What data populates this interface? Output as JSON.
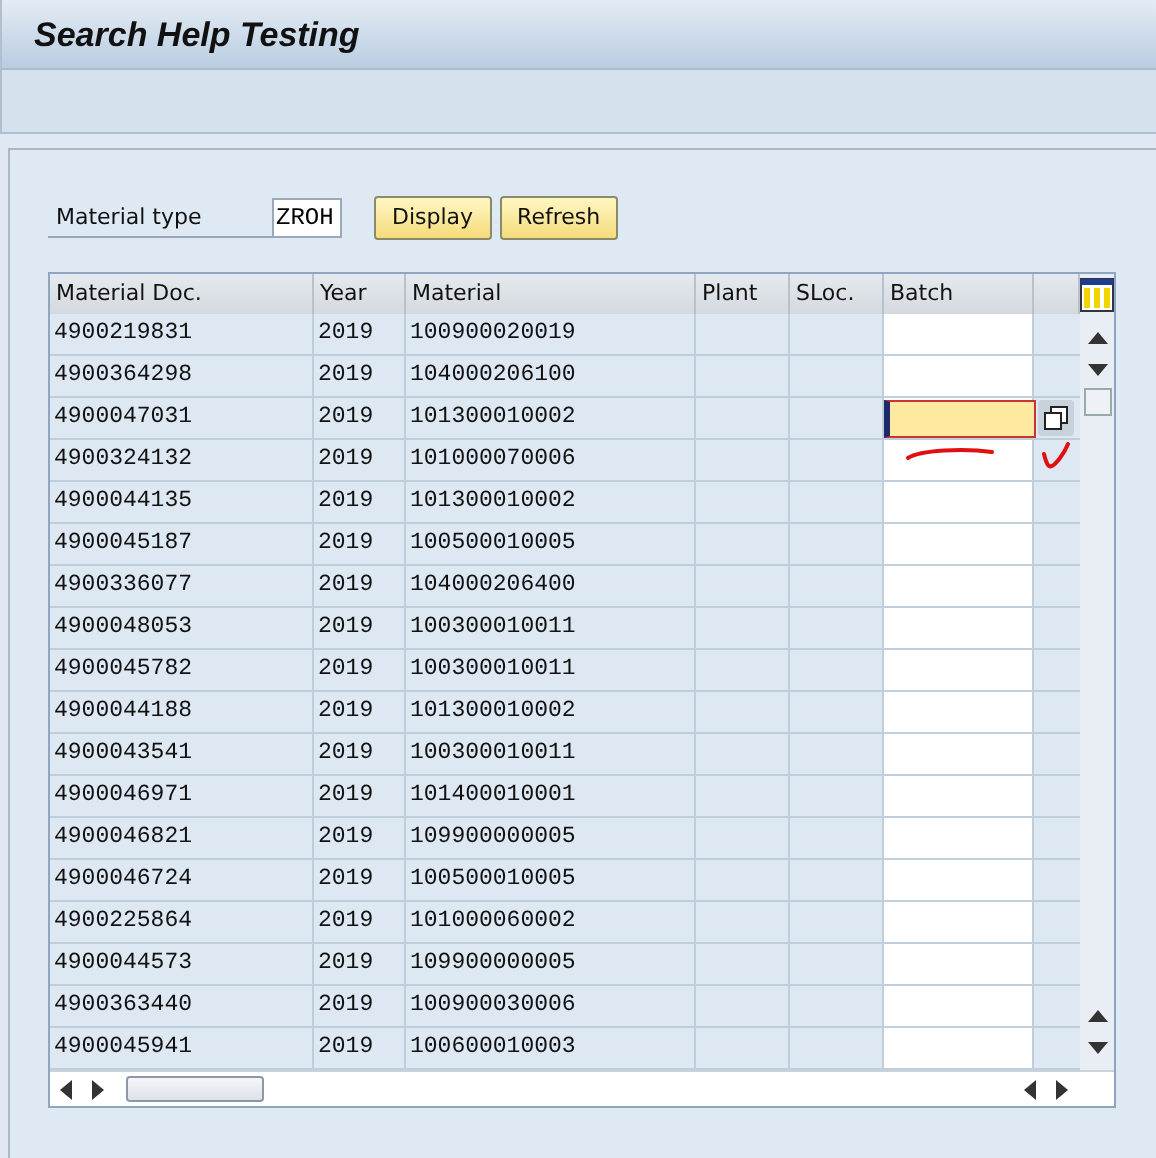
{
  "window": {
    "title": "Search Help Testing"
  },
  "form": {
    "label": "Material type",
    "value": "ZROH",
    "buttons": [
      "Display",
      "Refresh"
    ]
  },
  "table": {
    "columns": [
      "Material Doc.",
      "Year",
      "Material",
      "Plant",
      "SLoc.",
      "Batch"
    ],
    "rows": [
      {
        "material_doc": "4900219831",
        "year": "2019",
        "material": "100900020019",
        "focused": false
      },
      {
        "material_doc": "4900364298",
        "year": "2019",
        "material": "104000206100",
        "focused": false
      },
      {
        "material_doc": "4900047031",
        "year": "2019",
        "material": "101300010002",
        "focused": true
      },
      {
        "material_doc": "4900324132",
        "year": "2019",
        "material": "101000070006",
        "focused": false
      },
      {
        "material_doc": "4900044135",
        "year": "2019",
        "material": "101300010002",
        "focused": false
      },
      {
        "material_doc": "4900045187",
        "year": "2019",
        "material": "100500010005",
        "focused": false
      },
      {
        "material_doc": "4900336077",
        "year": "2019",
        "material": "104000206400",
        "focused": false
      },
      {
        "material_doc": "4900048053",
        "year": "2019",
        "material": "100300010011",
        "focused": false
      },
      {
        "material_doc": "4900045782",
        "year": "2019",
        "material": "100300010011",
        "focused": false
      },
      {
        "material_doc": "4900044188",
        "year": "2019",
        "material": "101300010002",
        "focused": false
      },
      {
        "material_doc": "4900043541",
        "year": "2019",
        "material": "100300010011",
        "focused": false
      },
      {
        "material_doc": "4900046971",
        "year": "2019",
        "material": "101400010001",
        "focused": false
      },
      {
        "material_doc": "4900046821",
        "year": "2019",
        "material": "109900000005",
        "focused": false
      },
      {
        "material_doc": "4900046724",
        "year": "2019",
        "material": "100500010005",
        "focused": false
      },
      {
        "material_doc": "4900225864",
        "year": "2019",
        "material": "101000060002",
        "focused": false
      },
      {
        "material_doc": "4900044573",
        "year": "2019",
        "material": "109900000005",
        "focused": false
      },
      {
        "material_doc": "4900363440",
        "year": "2019",
        "material": "100900030006",
        "focused": false
      },
      {
        "material_doc": "4900045941",
        "year": "2019",
        "material": "100600010003",
        "focused": false
      }
    ]
  }
}
